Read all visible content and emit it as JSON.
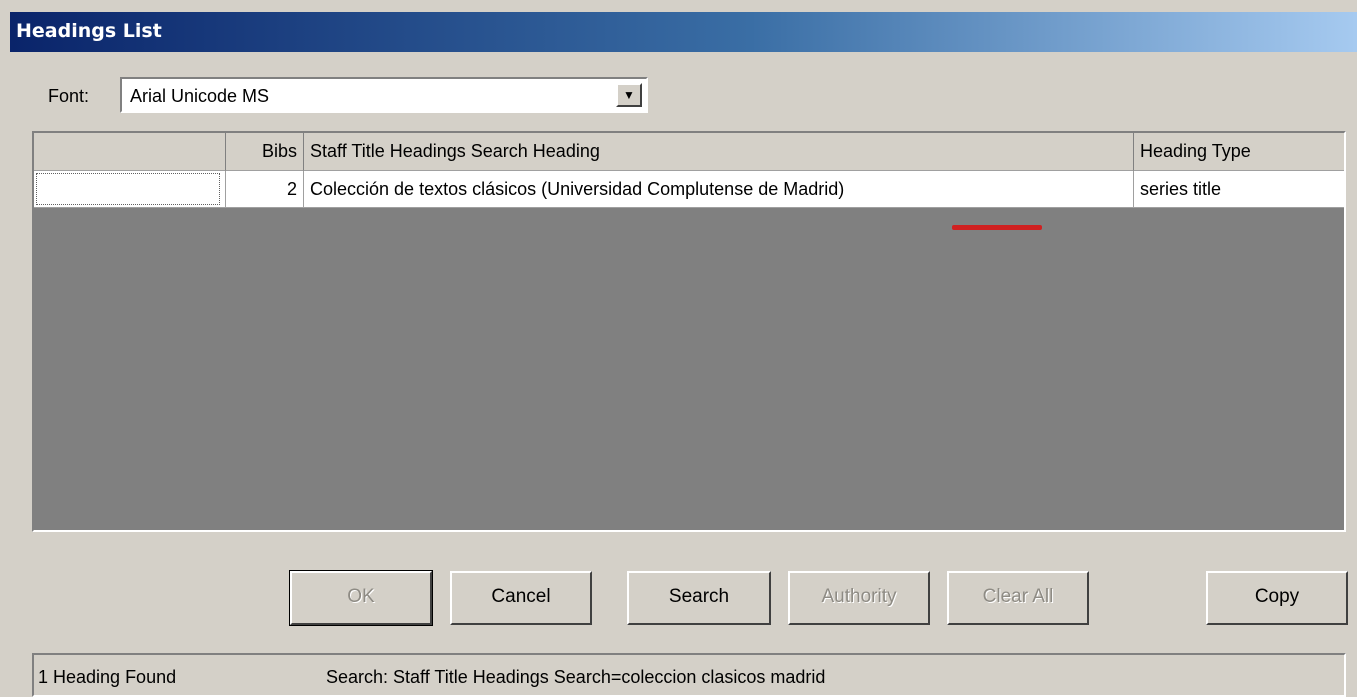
{
  "window": {
    "title": "Headings List"
  },
  "font": {
    "label": "Font:",
    "value": "Arial Unicode MS",
    "dropdown_icon": "triangle-down"
  },
  "table": {
    "headers": [
      "",
      "Bibs",
      "Staff Title Headings Search Heading",
      "Heading Type"
    ],
    "rows": [
      {
        "selector": "",
        "bibs": "2",
        "heading": "Colección de textos clásicos (Universidad Complutense de Madrid)",
        "type": "series title"
      }
    ]
  },
  "buttons": {
    "ok": "OK",
    "cancel": "Cancel",
    "search": "Search",
    "authority": "Authority",
    "clear_all": "Clear All",
    "copy": "Copy"
  },
  "status": {
    "count": "1 Heading Found",
    "search": "Search: Staff Title Headings Search=coleccion clasicos madrid"
  },
  "colors": {
    "titlebar_start": "#0a246a",
    "titlebar_end": "#a6caf0",
    "face": "#d4d0c8",
    "grid_empty": "#808080",
    "annotation_mark": "#d02020"
  }
}
